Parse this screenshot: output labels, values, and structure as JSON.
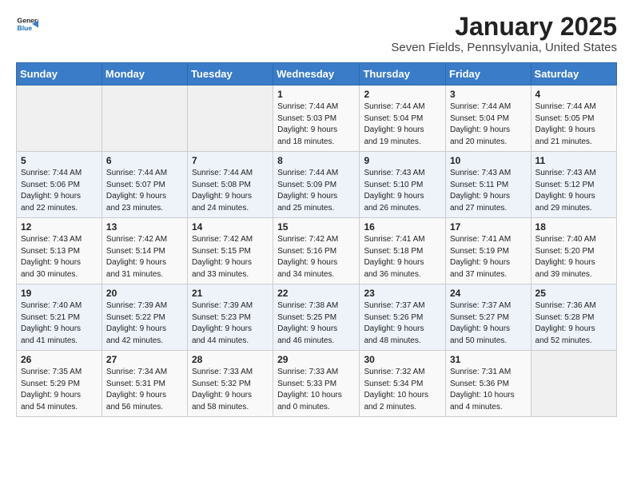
{
  "header": {
    "logo_line1": "General",
    "logo_line2": "Blue",
    "title": "January 2025",
    "subtitle": "Seven Fields, Pennsylvania, United States"
  },
  "days_of_week": [
    "Sunday",
    "Monday",
    "Tuesday",
    "Wednesday",
    "Thursday",
    "Friday",
    "Saturday"
  ],
  "weeks": [
    [
      {
        "day": "",
        "info": ""
      },
      {
        "day": "",
        "info": ""
      },
      {
        "day": "",
        "info": ""
      },
      {
        "day": "1",
        "info": "Sunrise: 7:44 AM\nSunset: 5:03 PM\nDaylight: 9 hours\nand 18 minutes."
      },
      {
        "day": "2",
        "info": "Sunrise: 7:44 AM\nSunset: 5:04 PM\nDaylight: 9 hours\nand 19 minutes."
      },
      {
        "day": "3",
        "info": "Sunrise: 7:44 AM\nSunset: 5:04 PM\nDaylight: 9 hours\nand 20 minutes."
      },
      {
        "day": "4",
        "info": "Sunrise: 7:44 AM\nSunset: 5:05 PM\nDaylight: 9 hours\nand 21 minutes."
      }
    ],
    [
      {
        "day": "5",
        "info": "Sunrise: 7:44 AM\nSunset: 5:06 PM\nDaylight: 9 hours\nand 22 minutes."
      },
      {
        "day": "6",
        "info": "Sunrise: 7:44 AM\nSunset: 5:07 PM\nDaylight: 9 hours\nand 23 minutes."
      },
      {
        "day": "7",
        "info": "Sunrise: 7:44 AM\nSunset: 5:08 PM\nDaylight: 9 hours\nand 24 minutes."
      },
      {
        "day": "8",
        "info": "Sunrise: 7:44 AM\nSunset: 5:09 PM\nDaylight: 9 hours\nand 25 minutes."
      },
      {
        "day": "9",
        "info": "Sunrise: 7:43 AM\nSunset: 5:10 PM\nDaylight: 9 hours\nand 26 minutes."
      },
      {
        "day": "10",
        "info": "Sunrise: 7:43 AM\nSunset: 5:11 PM\nDaylight: 9 hours\nand 27 minutes."
      },
      {
        "day": "11",
        "info": "Sunrise: 7:43 AM\nSunset: 5:12 PM\nDaylight: 9 hours\nand 29 minutes."
      }
    ],
    [
      {
        "day": "12",
        "info": "Sunrise: 7:43 AM\nSunset: 5:13 PM\nDaylight: 9 hours\nand 30 minutes."
      },
      {
        "day": "13",
        "info": "Sunrise: 7:42 AM\nSunset: 5:14 PM\nDaylight: 9 hours\nand 31 minutes."
      },
      {
        "day": "14",
        "info": "Sunrise: 7:42 AM\nSunset: 5:15 PM\nDaylight: 9 hours\nand 33 minutes."
      },
      {
        "day": "15",
        "info": "Sunrise: 7:42 AM\nSunset: 5:16 PM\nDaylight: 9 hours\nand 34 minutes."
      },
      {
        "day": "16",
        "info": "Sunrise: 7:41 AM\nSunset: 5:18 PM\nDaylight: 9 hours\nand 36 minutes."
      },
      {
        "day": "17",
        "info": "Sunrise: 7:41 AM\nSunset: 5:19 PM\nDaylight: 9 hours\nand 37 minutes."
      },
      {
        "day": "18",
        "info": "Sunrise: 7:40 AM\nSunset: 5:20 PM\nDaylight: 9 hours\nand 39 minutes."
      }
    ],
    [
      {
        "day": "19",
        "info": "Sunrise: 7:40 AM\nSunset: 5:21 PM\nDaylight: 9 hours\nand 41 minutes."
      },
      {
        "day": "20",
        "info": "Sunrise: 7:39 AM\nSunset: 5:22 PM\nDaylight: 9 hours\nand 42 minutes."
      },
      {
        "day": "21",
        "info": "Sunrise: 7:39 AM\nSunset: 5:23 PM\nDaylight: 9 hours\nand 44 minutes."
      },
      {
        "day": "22",
        "info": "Sunrise: 7:38 AM\nSunset: 5:25 PM\nDaylight: 9 hours\nand 46 minutes."
      },
      {
        "day": "23",
        "info": "Sunrise: 7:37 AM\nSunset: 5:26 PM\nDaylight: 9 hours\nand 48 minutes."
      },
      {
        "day": "24",
        "info": "Sunrise: 7:37 AM\nSunset: 5:27 PM\nDaylight: 9 hours\nand 50 minutes."
      },
      {
        "day": "25",
        "info": "Sunrise: 7:36 AM\nSunset: 5:28 PM\nDaylight: 9 hours\nand 52 minutes."
      }
    ],
    [
      {
        "day": "26",
        "info": "Sunrise: 7:35 AM\nSunset: 5:29 PM\nDaylight: 9 hours\nand 54 minutes."
      },
      {
        "day": "27",
        "info": "Sunrise: 7:34 AM\nSunset: 5:31 PM\nDaylight: 9 hours\nand 56 minutes."
      },
      {
        "day": "28",
        "info": "Sunrise: 7:33 AM\nSunset: 5:32 PM\nDaylight: 9 hours\nand 58 minutes."
      },
      {
        "day": "29",
        "info": "Sunrise: 7:33 AM\nSunset: 5:33 PM\nDaylight: 10 hours\nand 0 minutes."
      },
      {
        "day": "30",
        "info": "Sunrise: 7:32 AM\nSunset: 5:34 PM\nDaylight: 10 hours\nand 2 minutes."
      },
      {
        "day": "31",
        "info": "Sunrise: 7:31 AM\nSunset: 5:36 PM\nDaylight: 10 hours\nand 4 minutes."
      },
      {
        "day": "",
        "info": ""
      }
    ]
  ]
}
